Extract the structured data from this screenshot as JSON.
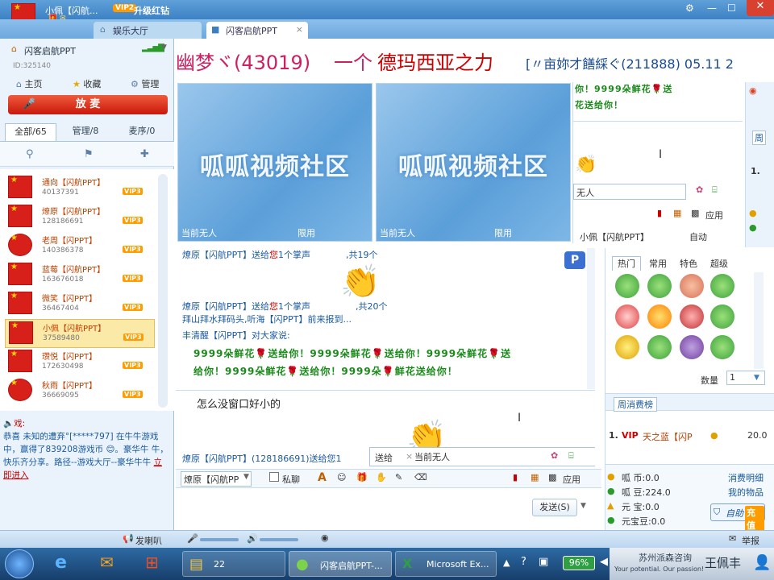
{
  "titlebar": {
    "user": "小佩【闪航...",
    "vip_badge": "VIP2",
    "upgrade": "升级红钻"
  },
  "tabs": [
    {
      "label": "娱乐大厅"
    },
    {
      "label": "闪客启航PPT",
      "close": "×"
    }
  ],
  "left": {
    "room_name": "闪客启航PPT",
    "room_id": "ID:325140",
    "home": "主页",
    "favorite": "收藏",
    "manage": "管理",
    "mic_button": "放 麦",
    "filter_tabs": [
      "全部/65",
      "管理/8",
      "麦序/0"
    ],
    "users": [
      {
        "name": "通向【闪航PPT】",
        "id": "40137391",
        "vip": "VIP3"
      },
      {
        "name": "燎原【闪航PPT】",
        "id": "128186691",
        "vip": "VIP3"
      },
      {
        "name": "老周【闪PPT】",
        "id": "140386378",
        "vip": "VIP3"
      },
      {
        "name": "蓝莓【闪航PPT】",
        "id": "163676018",
        "vip": "VIP3"
      },
      {
        "name": "微笑【闪PPT】",
        "id": "36467404",
        "vip": "VIP3"
      },
      {
        "name": "小佩【闪航PPT】",
        "id": "37589480",
        "vip": "VIP3"
      },
      {
        "name": "瓒悦【闪PPT】",
        "id": "172630498",
        "vip": "VIP3"
      },
      {
        "name": "秋雨【闪PPT】",
        "id": "36669095",
        "vip": "VIP3"
      }
    ],
    "broadcast": {
      "label": "戏:",
      "body": "恭喜 未知的遭弃°[*****797] 在牛牛游戏中，赢得了839208游戏币",
      "tail1": "。豪华牛",
      "tail2": "牛，快乐齐分享。路径--游戏大厅--豪华牛牛",
      "link": "立即进入"
    }
  },
  "banner": {
    "part1": "幽梦ヾ(43019)",
    "part2": "一个",
    "part3": "德玛西亚之力",
    "part4": "[〃亩妳才饍綵ぐ(211888) 05.11 2"
  },
  "videos": [
    {
      "logo": "呱呱视频社区",
      "status": "当前无人",
      "limit": "限用"
    },
    {
      "logo": "呱呱视频社区",
      "status": "当前无人",
      "limit": "限用"
    }
  ],
  "side_chat": {
    "line1": "你！9999朵鲜花",
    "line1b": "送",
    "line2": "花送给你！",
    "to_value": "无人",
    "app": "应用",
    "user": "小佩【闪航PPT】",
    "auto": "自动"
  },
  "chat": [
    {
      "a": "燎原【闪航PPT】",
      "b": "送给",
      "c": "您",
      "d": "1个掌声",
      "e": ",共19个"
    },
    {
      "a": "燎原【闪航PPT】",
      "b": "送给",
      "c": "您",
      "d": "1个掌声",
      "e": ",共20个"
    },
    {
      "text": "拜山拜水拜码头,听海【闪PPT】前来报到..."
    },
    {
      "a": "丰清醒【闪PPT】",
      "b": "对大家说:"
    },
    {
      "green1": "9999朵鲜花",
      "green1b": "送给你！9999朵鲜花",
      "green1c": "送给你！9999朵鲜花",
      "green1d": "送",
      "green2": "给你！9999朵鲜花",
      "green2b": "送给你！9999朵",
      "green2c": "鲜花送给你！"
    }
  ],
  "private_chat": {
    "line": "怎么没窗口好小的",
    "gift_line": "燎原【闪航PPT】(128186691)送给您1",
    "send_to": "送给",
    "send_value": "当前无人"
  },
  "input_bar": {
    "target": "燎原【闪航PP",
    "private": "私聊",
    "app": "应用",
    "send": "发送(S)"
  },
  "gifts": {
    "tabs": [
      "热门",
      "常用",
      "特色",
      "超级"
    ],
    "qty_label": "数量",
    "qty": "1",
    "weekly_title": "周消费榜",
    "rank": "1.",
    "rank_vip": "VIP",
    "rank_name": "天之蓝【闪P",
    "rank_value": "20.0"
  },
  "wallet": {
    "coin": "呱  币:0.0",
    "bean": "呱  豆:224.0",
    "yuan": "元  宝:0.0",
    "yuanbao": "元宝豆:0.0",
    "detail": "消费明细",
    "items": "我的物品",
    "recharge_a": "自助",
    "recharge_b": "充值"
  },
  "statusbar": {
    "speaker": "发喇叭",
    "report": "举报"
  },
  "taskbar": {
    "folder": "22",
    "app1": "闪客启航PPT-...",
    "app2": "Microsoft Ex...",
    "battery": "96%",
    "brand1": "苏州派森咨询",
    "brand2": "Your potential. Our passion!",
    "brand_name": "王佩丰"
  },
  "colors": {
    "accent": "#3b7fc2",
    "mic": "#d8251a",
    "banner_red": "#cc0000"
  }
}
